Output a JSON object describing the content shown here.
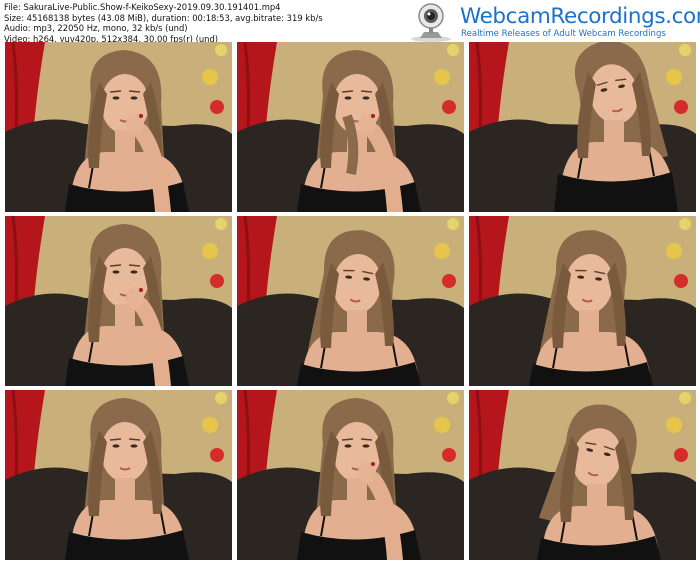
{
  "file_info": {
    "line1": "File: SakuraLive-Public.Show-f-KeikoSexy-2019.09.30.191401.mp4",
    "line2": "Size: 45168138 bytes (43.08 MiB), duration: 00:18:53, avg.bitrate: 319 kb/s",
    "line3": "Audio: mp3, 22050 Hz, mono, 32 kb/s (und)",
    "line4": "Video: h264, yuv420p, 512x384, 30.00 fps(r) (und)"
  },
  "logo": {
    "brand": "WebcamRecordings.com",
    "tagline": "Realtime Releases of Adult Webcam Recordings"
  },
  "colors": {
    "brand_blue": "#1a73c9",
    "curtain_red": "#b5161c",
    "wall": "#c9b07a",
    "sofa": "#2b2622"
  },
  "thumbnails": [
    {
      "pose": "hand-at-mouth"
    },
    {
      "pose": "hair-at-mouth"
    },
    {
      "pose": "head-tilted-up"
    },
    {
      "pose": "hand-at-mouth"
    },
    {
      "pose": "looking-down"
    },
    {
      "pose": "looking-down"
    },
    {
      "pose": "facing-camera"
    },
    {
      "pose": "hand-at-mouth"
    },
    {
      "pose": "head-bowed"
    }
  ]
}
